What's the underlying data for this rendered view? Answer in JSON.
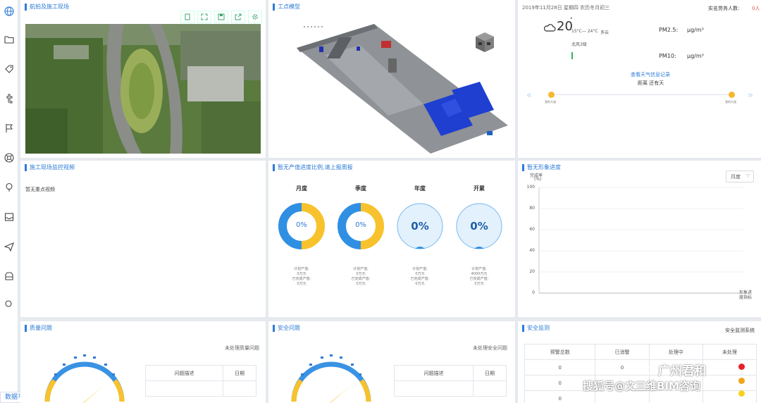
{
  "sidebar": {
    "items": [
      "globe-icon",
      "folder-icon",
      "tag-icon",
      "tumblr-icon",
      "flag-icon",
      "lifebuoy-icon",
      "bulb-icon",
      "inbox-icon",
      "send-icon",
      "archive-icon",
      "search-icon"
    ],
    "footer_label": "数据平台"
  },
  "aerial": {
    "title": "航拍及施工现场"
  },
  "model": {
    "title": "工点模型"
  },
  "weather": {
    "date": "2019年11月28日 星期四 农历冬月初三",
    "workers_label": "实名劳务人数:",
    "workers_value": "0人",
    "temp": "20",
    "temp_range": "15°C— 24°C",
    "condition": "多云",
    "wind": "北风3级",
    "pm25_label": "PM2.5:",
    "pm25_unit": "μg/m³",
    "pm10_label": "PM10:",
    "pm10_unit": "μg/m³",
    "link": "查看天气信息记录",
    "distance": "距离 还有天",
    "left_point": "我的大道",
    "right_point": "我的大道"
  },
  "video": {
    "title": "施工现场监控视频",
    "empty": "暂无重点视频"
  },
  "output": {
    "title": "暂无产值进度比例,请上报周报",
    "rings": [
      {
        "label": "月度",
        "value": "0%",
        "notes": [
          "计划产值:",
          "0万元",
          "已完成产值:",
          "0万元"
        ]
      },
      {
        "label": "季度",
        "value": "0%",
        "notes": [
          "计划产值:",
          "0万元",
          "已完成产值:",
          "0万元"
        ]
      },
      {
        "label": "年度",
        "value": "0%",
        "notes": [
          "计划产值:",
          "0万元",
          "已完成产值:",
          "0万元"
        ]
      },
      {
        "label": "开累",
        "value": "0%",
        "notes": [
          "计划产值:",
          "4000万元",
          "已完成产值:",
          "0万元"
        ]
      }
    ]
  },
  "progress": {
    "title": "暂无形象进度",
    "select": "月度",
    "ylabel1": "完成率",
    "ylabel2": "(%)",
    "yticks": [
      "100",
      "80",
      "60",
      "40",
      "20",
      "0"
    ],
    "xlabel1": "形象进",
    "xlabel2": "度指标"
  },
  "quality": {
    "title": "质量问题",
    "unhandled": "未处理质量问题",
    "col1": "问题描述",
    "col2": "日期"
  },
  "safety": {
    "title": "安全问题",
    "unhandled": "未处理安全问题",
    "col1": "问题描述",
    "col2": "日期"
  },
  "monitor": {
    "title": "安全监测",
    "system": "安全监测系统",
    "headers": [
      "预警总数",
      "已消警",
      "处理中",
      "未处理"
    ],
    "rows": [
      [
        "0",
        "0",
        "",
        ""
      ],
      [
        "0",
        "",
        "",
        ""
      ],
      [
        "0",
        "",
        "",
        ""
      ]
    ]
  },
  "watermark": {
    "brand": "广州君和",
    "line": "搜狐号@文三维BIM咨询"
  }
}
